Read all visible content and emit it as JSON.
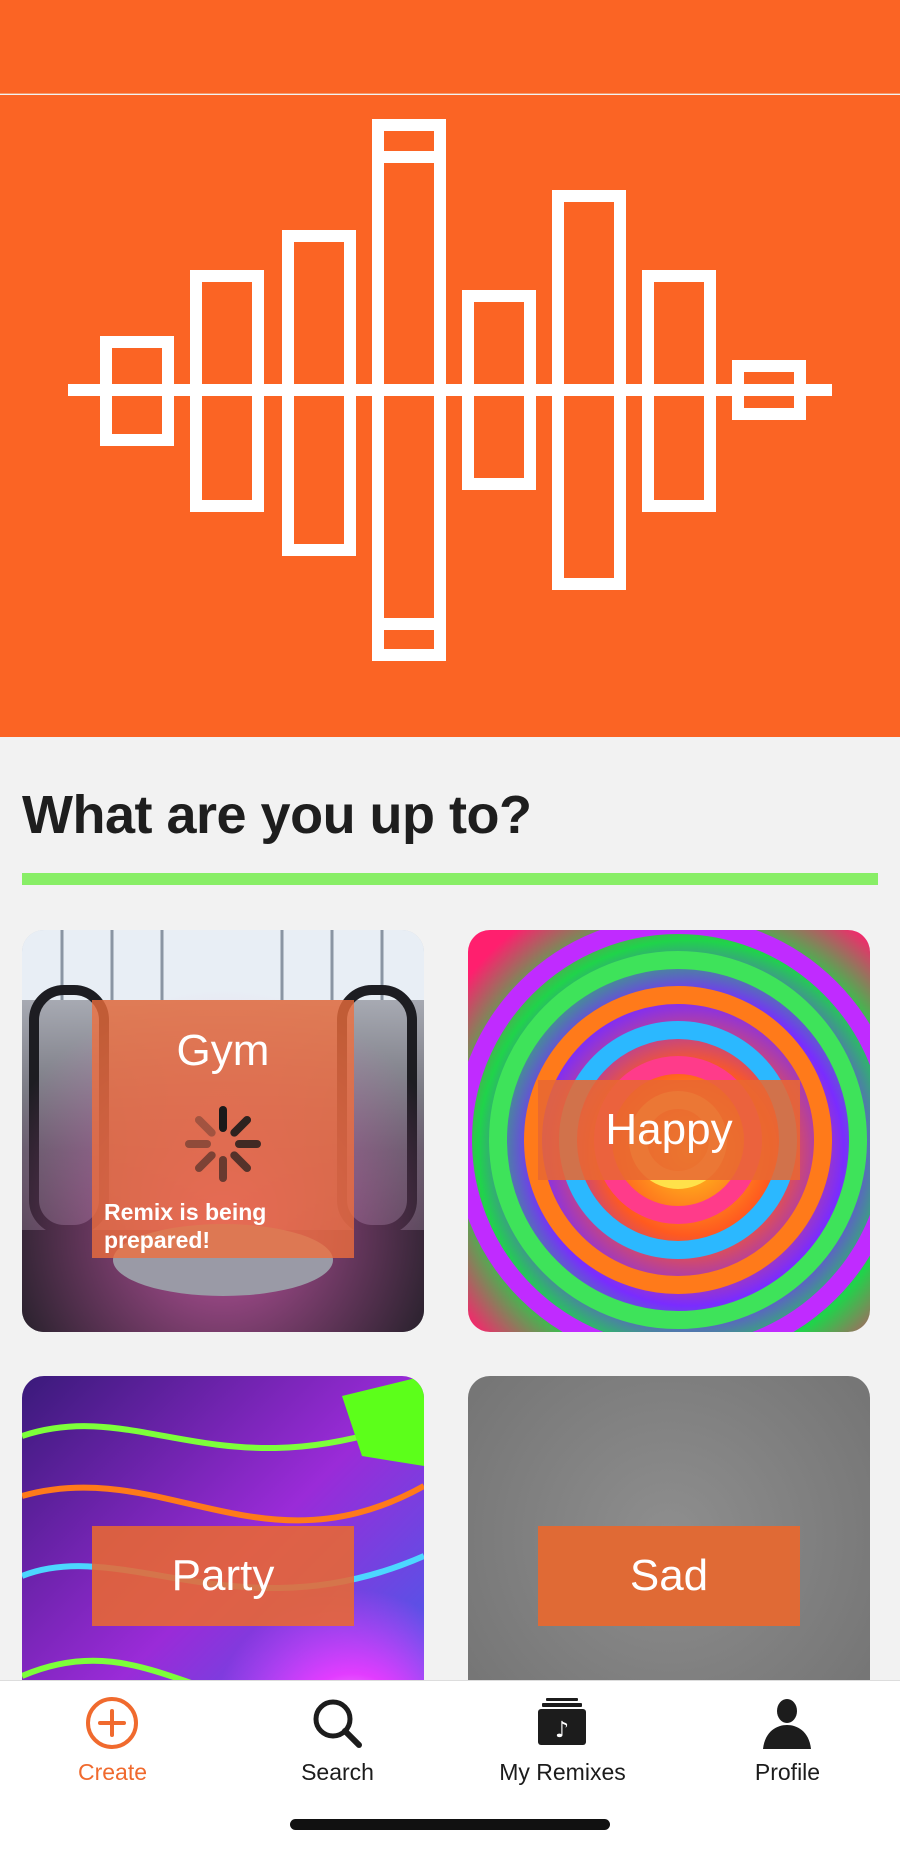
{
  "colors": {
    "brand_orange": "#fb6424",
    "accent_green": "#88ee66",
    "tab_active": "#f06a2e",
    "tab_inactive": "#1c1c1c"
  },
  "hero": {
    "icon": "sound-wave-logo"
  },
  "main": {
    "title": "What are you up to?",
    "cards": [
      {
        "label": "Gym",
        "status": "Remix is being prepared!",
        "loading": true
      },
      {
        "label": "Happy"
      },
      {
        "label": "Party"
      },
      {
        "label": "Sad"
      }
    ]
  },
  "tab_bar": {
    "active": "Create",
    "tabs": [
      {
        "label": "Create",
        "icon": "plus-circle-icon"
      },
      {
        "label": "Search",
        "icon": "search-icon"
      },
      {
        "label": "My Remixes",
        "icon": "music-folder-icon"
      },
      {
        "label": "Profile",
        "icon": "person-icon"
      }
    ]
  }
}
